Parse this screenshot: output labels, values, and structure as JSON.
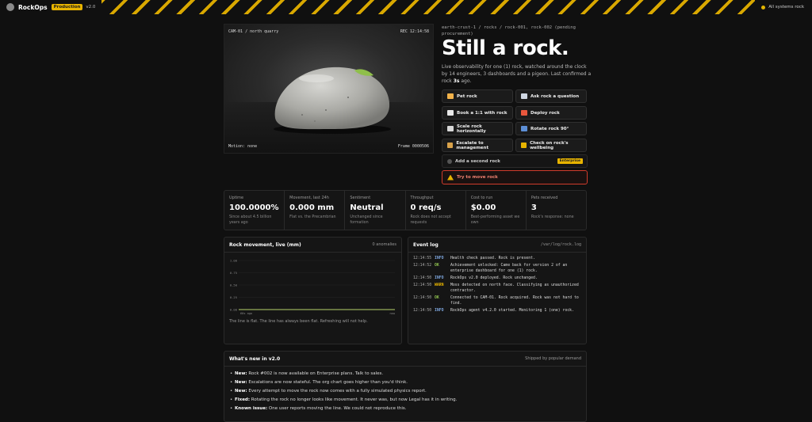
{
  "topbar": {
    "brand": "RockOps",
    "env": "Production",
    "version": "v2.0",
    "status": "All systems rock"
  },
  "camera": {
    "name": "CAM-01 / north quarry",
    "rec": "REC 12:14:58",
    "motion": "Motion: none",
    "frame": "Frame 0000506"
  },
  "header": {
    "breadcrumb": "earth-crust-1 / rocks / rock-001, rock-002 (pending procurement)",
    "title": "Still a rock.",
    "desc_pre": "Live observability for one (1) rock, watched around the clock by 14 engineers, 3 dashboards and a pigeon. Last confirmed a rock ",
    "desc_bold": "3s",
    "desc_post": " ago."
  },
  "actions": [
    {
      "label": "Pet rock",
      "icon": "hand-icon",
      "color": "#f2b24a"
    },
    {
      "label": "Ask rock a question",
      "icon": "speech-bubble-icon",
      "color": "#cfd6e2"
    },
    {
      "label": "Book a 1:1 with rock",
      "icon": "calendar-icon",
      "color": "#e8e8e8"
    },
    {
      "label": "Deploy rock",
      "icon": "rocket-icon",
      "color": "#e8573d"
    },
    {
      "label": "Scale rock horizontally",
      "icon": "chart-icon",
      "color": "#d8d8d8"
    },
    {
      "label": "Rotate rock 90°",
      "icon": "rotate-icon",
      "color": "#5d8fd6"
    },
    {
      "label": "Escalate to management",
      "icon": "escalate-icon",
      "color": "#d9a24a"
    },
    {
      "label": "Check on rock's wellbeing",
      "icon": "warning-icon",
      "color": "#e8b400"
    }
  ],
  "second_rock": {
    "label": "Add a second rock",
    "badge": "Enterprise"
  },
  "move_rock": {
    "label": "Try to move rock"
  },
  "stats": [
    {
      "k": "Uptime",
      "v": "100.0000%",
      "s": "Since about 4.5 billion years ago"
    },
    {
      "k": "Movement, last 24h",
      "v": "0.000 mm",
      "s": "Flat vs. the Precambrian"
    },
    {
      "k": "Sentiment",
      "v": "Neutral",
      "s": "Unchanged since formation"
    },
    {
      "k": "Throughput",
      "v": "0 req/s",
      "s": "Rock does not accept requests"
    },
    {
      "k": "Cost to run",
      "v": "$0.00",
      "s": "Best-performing asset we own"
    },
    {
      "k": "Pets received",
      "v": "3",
      "s": "Rock's response: none"
    }
  ],
  "movement": {
    "title": "Rock movement, live (mm)",
    "meta": "0 anomalies",
    "note": "The line is flat. The line has always been flat. Refreshing will not help.",
    "chart_data": {
      "type": "line",
      "title": "Rock movement, live (mm)",
      "yticks": [
        "1.00",
        "0.75",
        "0.50",
        "0.25",
        "0.00"
      ],
      "ylim": [
        0,
        1
      ],
      "xlabels": [
        "60s ago",
        "now"
      ],
      "series": [
        {
          "values": [
            0,
            0,
            0,
            0,
            0,
            0,
            0,
            0,
            0,
            0,
            0,
            0,
            0,
            0,
            0,
            0,
            0,
            0,
            0,
            0,
            0,
            0,
            0,
            0,
            0,
            0,
            0,
            0,
            0,
            0,
            0,
            0,
            0,
            0,
            0,
            0,
            0,
            0,
            0,
            0,
            0,
            0,
            0,
            0,
            0,
            0,
            0,
            0,
            0,
            0,
            0,
            0,
            0,
            0,
            0,
            0,
            0,
            0,
            0,
            0,
            0
          ]
        }
      ],
      "line_color": "#b8d26a"
    }
  },
  "eventlog": {
    "title": "Event log",
    "path": "/var/log/rock.log",
    "rows": [
      {
        "ts": "12:14:55",
        "lv": "INFO",
        "color": "#7fa8e0",
        "msg": "Health check passed. Rock is present."
      },
      {
        "ts": "12:14:52",
        "lv": "OK",
        "color": "#8ec04e",
        "msg": "Achievement unlocked: Came back for version 2 of an enterprise dashboard for one (1) rock."
      },
      {
        "ts": "12:14:50",
        "lv": "INFO",
        "color": "#7fa8e0",
        "msg": "RockOps v2.0 deployed. Rock unchanged."
      },
      {
        "ts": "12:14:50",
        "lv": "WARN",
        "color": "#e8b400",
        "msg": "Moss detected on north face. Classifying as unauthorized contractor."
      },
      {
        "ts": "12:14:50",
        "lv": "OK",
        "color": "#8ec04e",
        "msg": "Connected to CAM-01. Rock acquired. Rock was not hard to find."
      },
      {
        "ts": "12:14:50",
        "lv": "INFO",
        "color": "#7fa8e0",
        "msg": "RockOps agent v4.2.0 started. Monitoring 1 (one) rock."
      }
    ]
  },
  "whatsnew": {
    "title": "What's new in v2.0",
    "meta": "Shipped by popular demand",
    "items": [
      {
        "tag": "New:",
        "text": " Rock #002 is now available on Enterprise plans. Talk to sales."
      },
      {
        "tag": "New:",
        "text": " Escalations are now stateful. The org chart goes higher than you'd think."
      },
      {
        "tag": "New:",
        "text": " Every attempt to move the rock now comes with a fully simulated physics report."
      },
      {
        "tag": "Fixed:",
        "text": " Rotating the rock no longer looks like movement. It never was, but now Legal has it in writing."
      },
      {
        "tag": "Known issue:",
        "text": " One user reports moving the line. We could not reproduce this."
      }
    ]
  }
}
